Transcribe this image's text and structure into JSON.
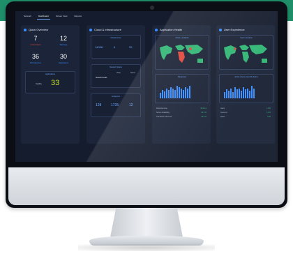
{
  "nav": {
    "tabs": [
      "Network",
      "Dashboard",
      "Screen View",
      "Reports"
    ],
    "active": 1
  },
  "quick_overview": {
    "title": "Quick Overview",
    "stats": [
      {
        "value": "7",
        "label": "Critical Alerts",
        "color": "#e2453c"
      },
      {
        "value": "12",
        "label": "Warnings",
        "color": "#3a8cff"
      },
      {
        "value": "36",
        "label": "Web Services",
        "color": "#3a8cff"
      },
      {
        "value": "30",
        "label": "Applications",
        "color": "#3a8cff"
      }
    ],
    "apps_box": {
      "title": "Applications",
      "label": "Healthy",
      "value": "33"
    }
  },
  "cloud": {
    "title": "Cloud & Infrastructure",
    "box1": {
      "title": "Infrastructure",
      "values": [
        "14098",
        "6",
        "25"
      ]
    },
    "box2": {
      "title": "Network Status",
      "col1": "Value",
      "col2": "Status",
      "row_label": "Network Health"
    },
    "box3": {
      "title": "Endpoints",
      "values": [
        "128",
        "1735",
        "12"
      ]
    }
  },
  "app_health": {
    "title": "Application Health",
    "map_title": "Active Locations",
    "bars_title": "Response",
    "rows": [
      {
        "label": "Response time",
        "value": "98.5 ms"
      },
      {
        "label": "Server Availability",
        "value": "99.9 %"
      },
      {
        "label": "Transaction Success",
        "value": "98.8 %"
      }
    ]
  },
  "user_exp": {
    "title": "User Experience",
    "map_title": "User Locations",
    "bars_title": "Active Users (Last 24 Hours)",
    "rows": [
      {
        "label": "Users",
        "value": "1,234"
      },
      {
        "label": "Sessions",
        "value": "5,678"
      },
      {
        "label": "Apdex",
        "value": "0.94"
      }
    ]
  },
  "bars": {
    "app": [
      4,
      6,
      5,
      7,
      6,
      8,
      7,
      6,
      9,
      8,
      7,
      6,
      8,
      7,
      9
    ],
    "user": [
      5,
      7,
      6,
      8,
      5,
      9,
      7,
      8,
      6,
      9,
      7,
      8,
      6,
      10,
      8
    ]
  }
}
